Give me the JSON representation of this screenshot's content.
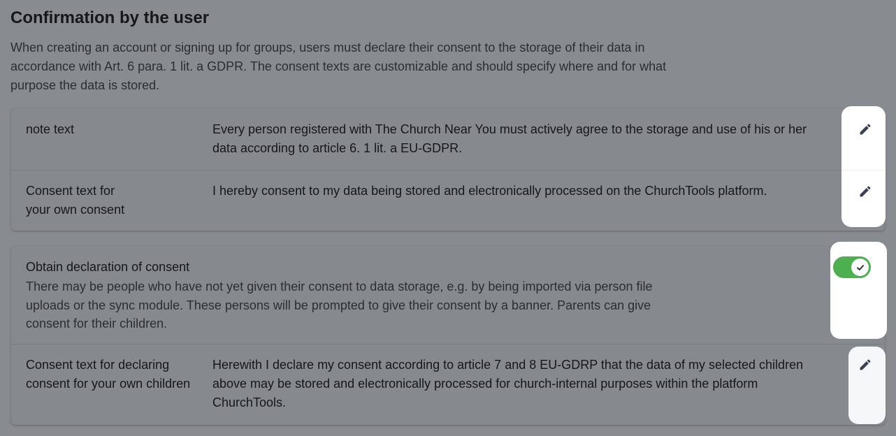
{
  "section": {
    "title": "Confirmation by the user",
    "description": "When creating an account or signing up for groups, users must declare their consent to the storage of their data in accordance with Art. 6 para. 1 lit. a GDPR. The consent texts are customizable and should specify where and for what purpose the data is stored."
  },
  "consent_texts": {
    "rows": [
      {
        "label": "note text",
        "value": "Every person registered with The Church Near You must actively agree to the storage and use of his or her data according to article 6. 1 lit. a EU-GDPR.",
        "action_icon": "pencil-icon"
      },
      {
        "label": "Consent text for your own consent",
        "value": "I hereby consent to my data being stored and electronically processed on the ChurchTools platform.",
        "action_icon": "pencil-icon"
      }
    ]
  },
  "declaration": {
    "label": "Obtain declaration of consent",
    "description": "There may be people who have not yet given their consent to data storage, e.g. by being imported via person file uploads or the sync module. These persons will be prompted to give their consent by a banner. Parents can give consent for their children.",
    "toggle_state": "on",
    "toggle_color": "#4caf50",
    "children_row": {
      "label": "Consent text for declaring consent for your own children",
      "value": "Herewith I declare my consent according to article 7 and 8 EU-GDRP that the data of my selected children above may be stored and electronically processed for church-internal purposes within the platform ChurchTools.",
      "action_icon": "pencil-icon"
    }
  }
}
